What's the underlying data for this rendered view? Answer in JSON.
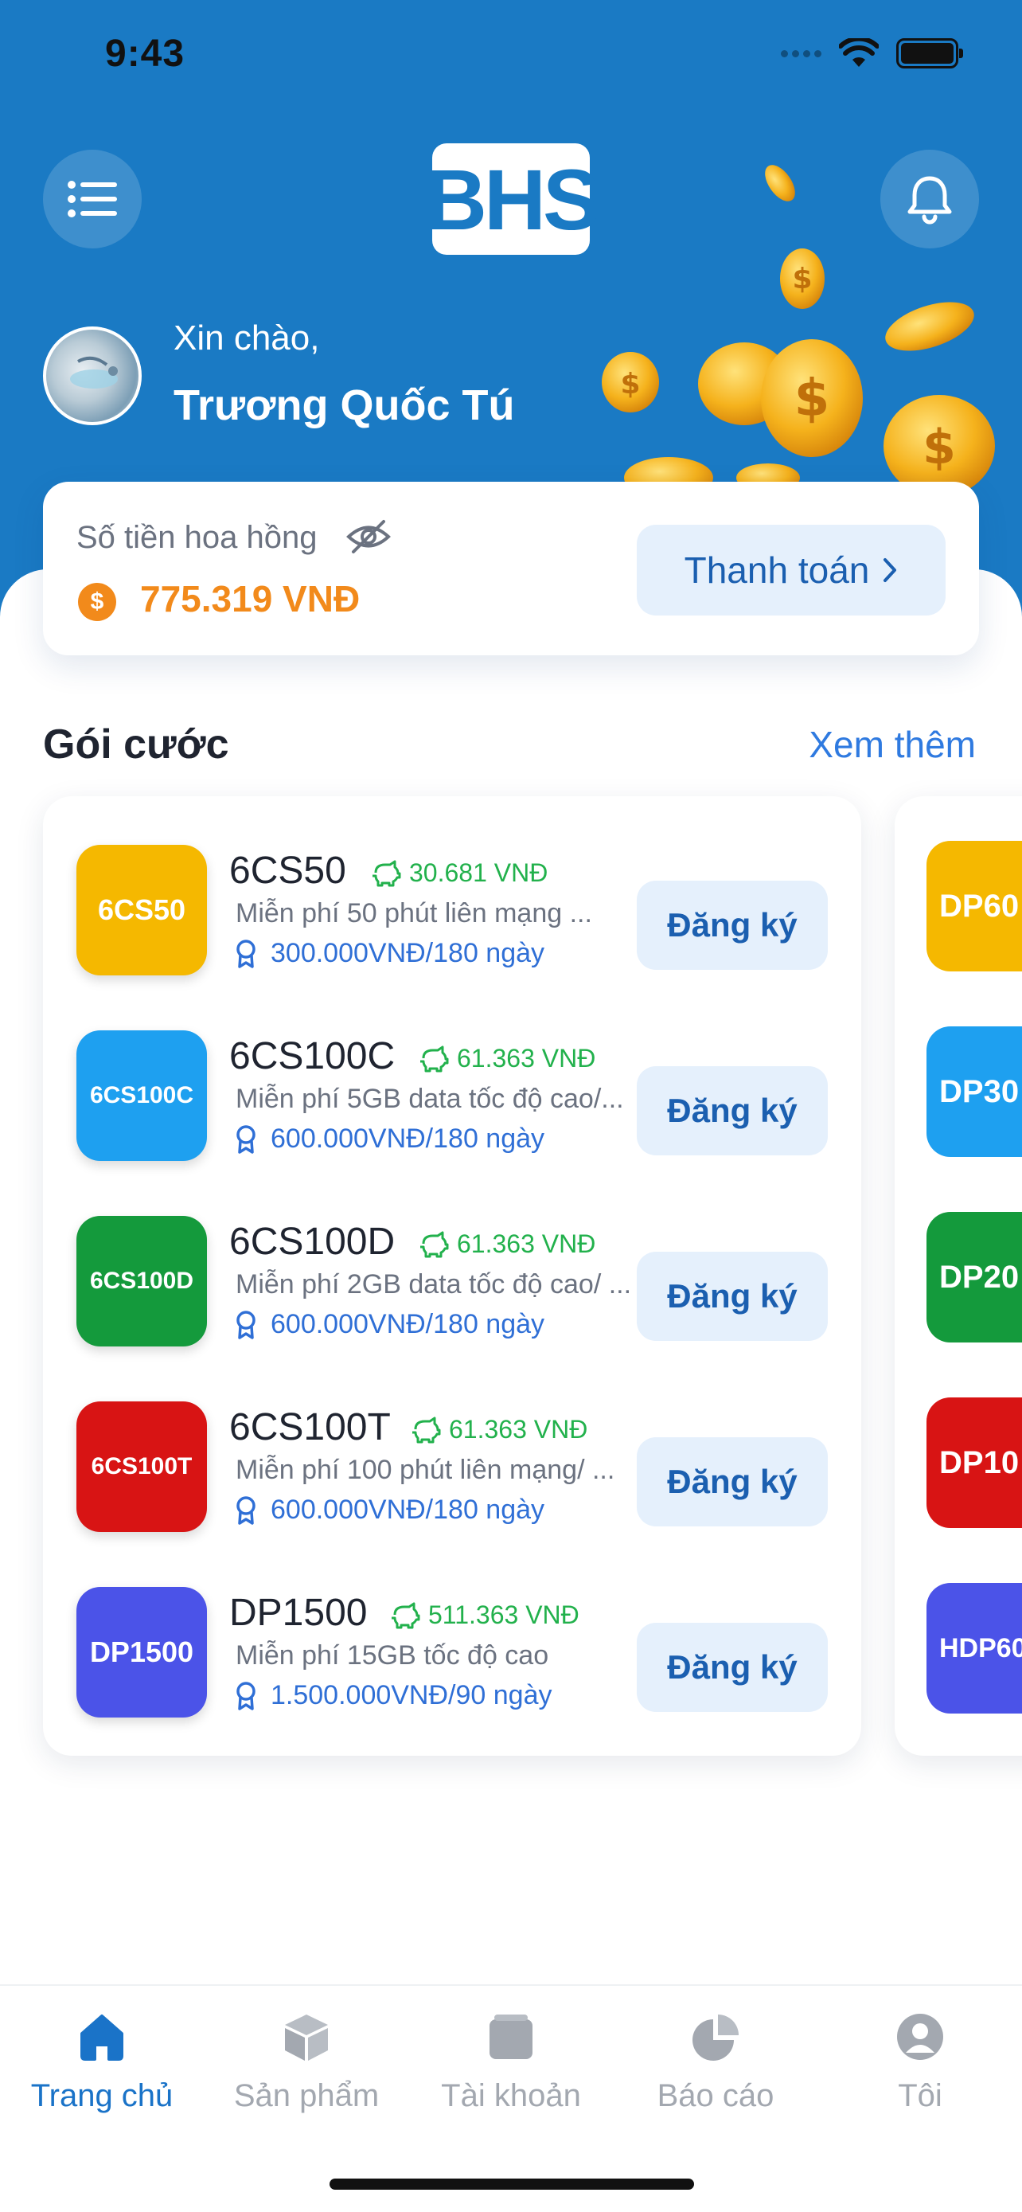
{
  "status_bar": {
    "time": "9:43"
  },
  "header": {
    "logo_text": "BHS",
    "greeting": "Xin chào,",
    "user_name": "Trương Quốc Tú"
  },
  "commission": {
    "label": "Số tiền hoa hồng",
    "amount": "775.319 VNĐ",
    "pay_button": "Thanh toán"
  },
  "packages_section": {
    "title": "Gói cước",
    "see_more": "Xem thêm"
  },
  "packages": [
    {
      "thumb": "6CS50",
      "name": "6CS50",
      "bonus": "30.681 VNĐ",
      "desc": "Miễn phí 50 phút liên mạng ...",
      "price": "300.000VNĐ/180 ngày",
      "button": "Đăng ký",
      "color": "#f5b800"
    },
    {
      "thumb": "6CS100C",
      "name": "6CS100C",
      "bonus": "61.363 VNĐ",
      "desc": "Miễn phí 5GB data tốc độ cao/...",
      "price": "600.000VNĐ/180 ngày",
      "button": "Đăng ký",
      "color": "#1ea0f0"
    },
    {
      "thumb": "6CS100D",
      "name": "6CS100D",
      "bonus": "61.363 VNĐ",
      "desc": "Miễn phí 2GB data tốc độ cao/ ...",
      "price": "600.000VNĐ/180 ngày",
      "button": "Đăng ký",
      "color": "#149a3c"
    },
    {
      "thumb": "6CS100T",
      "name": "6CS100T",
      "bonus": "61.363 VNĐ",
      "desc": "Miễn phí 100 phút liên mạng/ ...",
      "price": "600.000VNĐ/180 ngày",
      "button": "Đăng ký",
      "color": "#d81414"
    },
    {
      "thumb": "DP1500",
      "name": "DP1500",
      "bonus": "511.363 VNĐ",
      "desc": "Miễn phí 15GB tốc độ cao",
      "price": "1.500.000VNĐ/90 ngày",
      "button": "Đăng ký",
      "color": "#4b53e8"
    }
  ],
  "next_column_thumbs": [
    {
      "text": "DP60",
      "color": "#f5b800"
    },
    {
      "text": "DP30",
      "color": "#1ea0f0"
    },
    {
      "text": "DP20",
      "color": "#149a3c"
    },
    {
      "text": "DP10",
      "color": "#d81414"
    },
    {
      "text": "HDP60",
      "color": "#4b53e8"
    }
  ],
  "bottom_nav": [
    {
      "label": "Trang chủ",
      "icon": "home-icon",
      "active": true
    },
    {
      "label": "Sản phẩm",
      "icon": "box-icon",
      "active": false
    },
    {
      "label": "Tài khoản",
      "icon": "wallet-icon",
      "active": false
    },
    {
      "label": "Báo cáo",
      "icon": "pie-chart-icon",
      "active": false
    },
    {
      "label": "Tôi",
      "icon": "user-icon",
      "active": false
    }
  ],
  "colors": {
    "primary": "#1a7ac4",
    "accent_orange": "#f28a1b",
    "bonus_green": "#22b14c",
    "link_blue": "#2f7ae0"
  }
}
